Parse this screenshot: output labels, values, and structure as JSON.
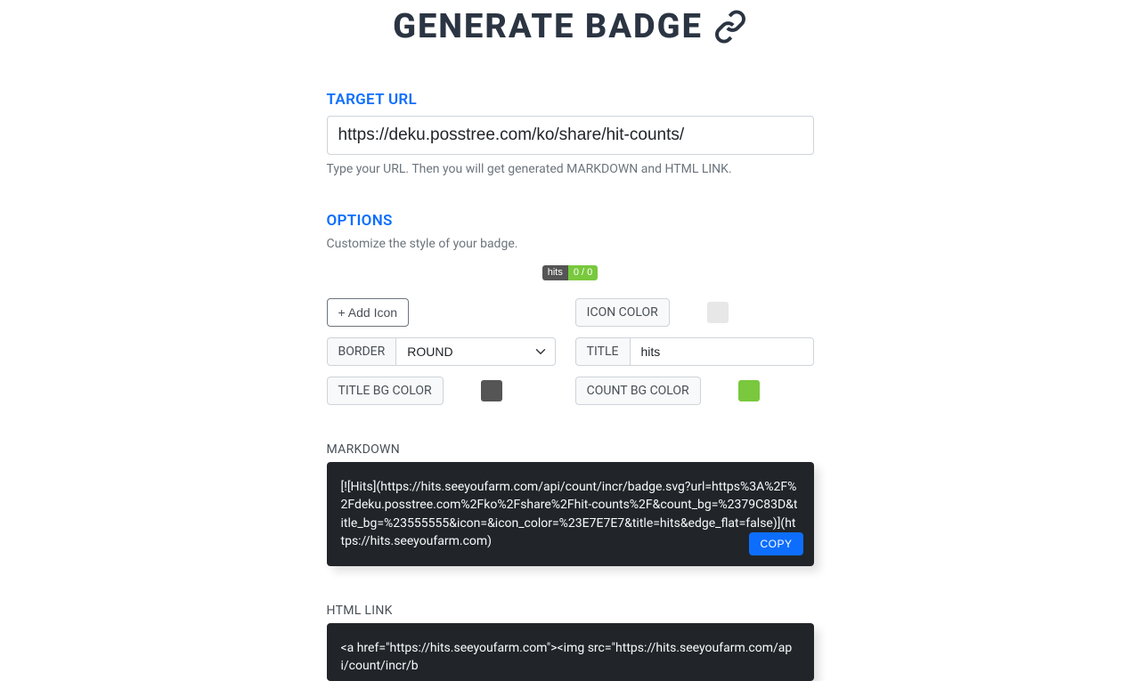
{
  "header": {
    "title": "GENERATE BADGE"
  },
  "target": {
    "label": "TARGET URL",
    "value": "https://deku.posstree.com/ko/share/hit-counts/",
    "helper": "Type your URL. Then you will get generated MARKDOWN and HTML LINK."
  },
  "options": {
    "label": "OPTIONS",
    "helper": "Customize the style of your badge.",
    "badge_preview": {
      "left": "hits",
      "right": "0 / 0"
    },
    "add_icon_label": "+ Add Icon",
    "icon_color_label": "ICON COLOR",
    "icon_color_value": "#E7E7E7",
    "border_label": "BORDER",
    "border_value": "ROUND",
    "title_label": "TITLE",
    "title_value": "hits",
    "title_bg_label": "TITLE BG COLOR",
    "title_bg_value": "#555555",
    "count_bg_label": "COUNT BG COLOR",
    "count_bg_value": "#79C83D"
  },
  "markdown": {
    "label": "MARKDOWN",
    "code": "[![Hits](https://hits.seeyoufarm.com/api/count/incr/badge.svg?url=https%3A%2F%2Fdeku.posstree.com%2Fko%2Fshare%2Fhit-counts%2F&count_bg=%2379C83D&title_bg=%23555555&icon=&icon_color=%23E7E7E7&title=hits&edge_flat=false)](https://hits.seeyoufarm.com)",
    "copy_label": "COPY"
  },
  "htmllink": {
    "label": "HTML LINK",
    "code": "<a href=\"https://hits.seeyoufarm.com\"><img src=\"https://hits.seeyoufarm.com/api/count/incr/b"
  }
}
